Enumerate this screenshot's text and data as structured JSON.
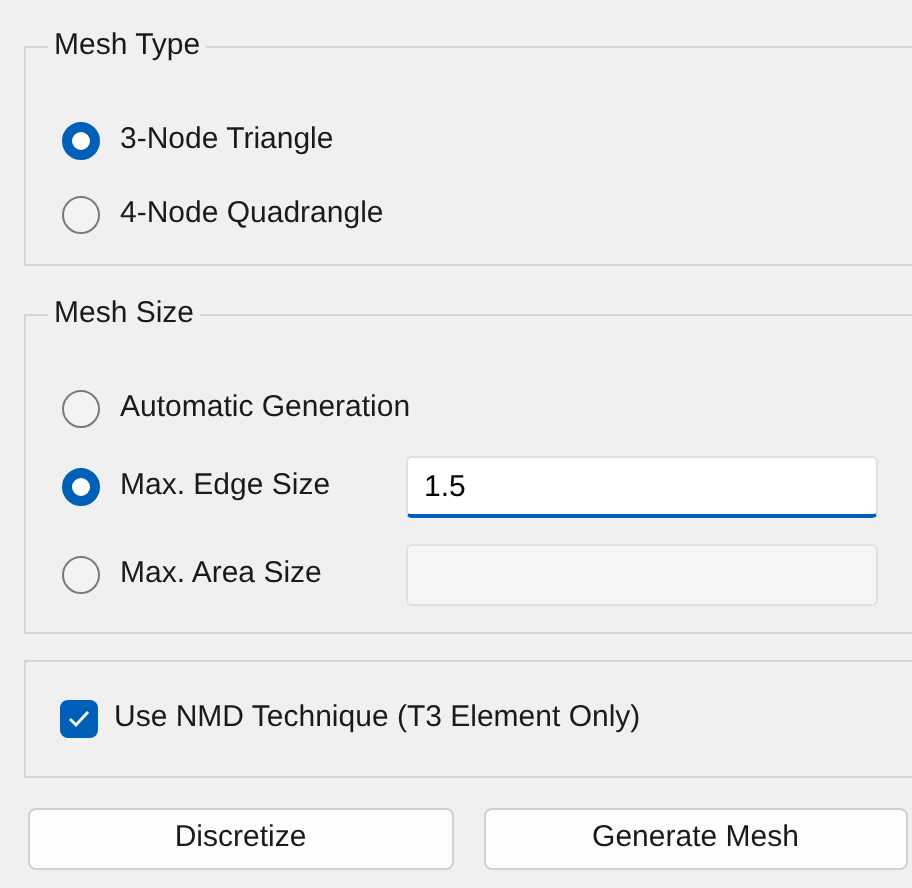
{
  "groups": [
    {
      "title": "Mesh Type",
      "options": [
        {
          "label": "3-Node Triangle",
          "selected": true
        },
        {
          "label": "4-Node Quadrangle",
          "selected": false
        }
      ]
    },
    {
      "title": "Mesh Size",
      "options": [
        {
          "label": "Automatic Generation",
          "selected": false
        },
        {
          "label": "Max. Edge Size",
          "selected": true,
          "field": {
            "value": "1.5",
            "disabled": false
          }
        },
        {
          "label": "Max. Area Size",
          "selected": false,
          "field": {
            "disabled": true
          }
        }
      ]
    }
  ],
  "nmd_option": {
    "label": "Use NMD Technique (T3 Element Only)",
    "checked": true
  },
  "buttons": [
    "Discretize",
    "Generate Mesh"
  ]
}
